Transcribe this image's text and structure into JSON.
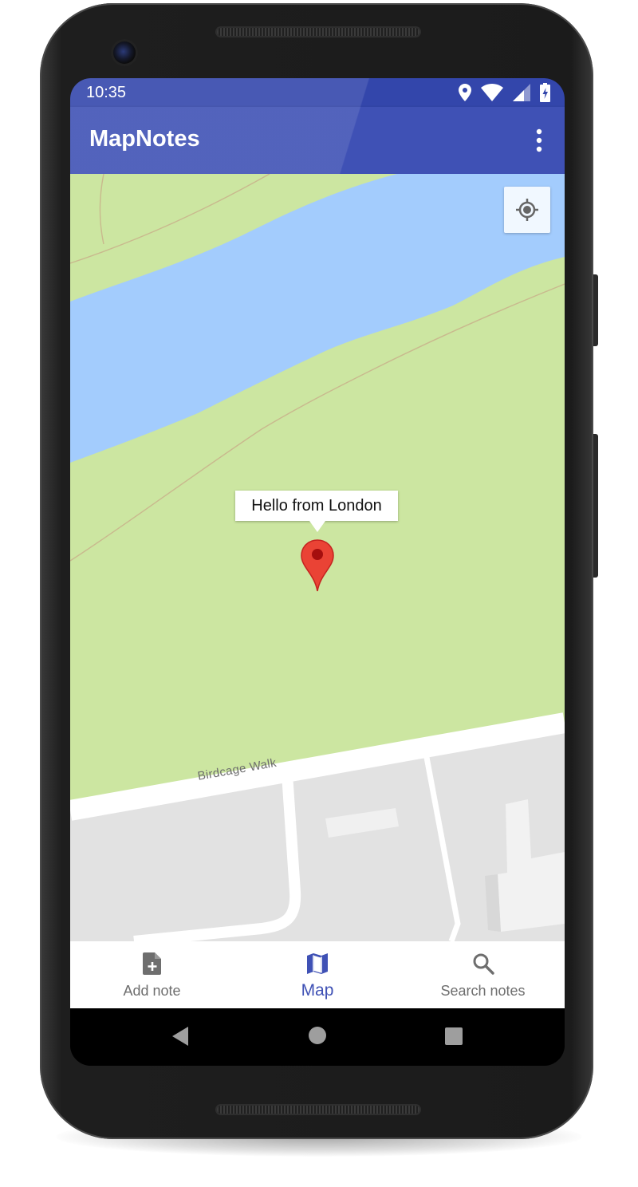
{
  "status_bar": {
    "time": "10:35"
  },
  "app_bar": {
    "title": "MapNotes",
    "menu_icon": "more-vert-icon"
  },
  "map": {
    "info_window_text": "Hello from London",
    "street_label": "Birdcage Walk",
    "locate_icon": "my-location-icon",
    "colors": {
      "park": "#cce6a1",
      "water": "#a3ccfd",
      "buildings": "#e2e2e2",
      "road": "#ffffff",
      "marker": "#ea4335"
    }
  },
  "bottom_nav": {
    "items": [
      {
        "label": "Add note",
        "icon": "note-add-icon",
        "active": false
      },
      {
        "label": "Map",
        "icon": "map-icon",
        "active": true
      },
      {
        "label": "Search notes",
        "icon": "search-icon",
        "active": false
      }
    ]
  },
  "colors": {
    "primary": "#3f51b5",
    "primary_dark": "#3346ab",
    "inactive_nav": "#6e6e6e"
  }
}
